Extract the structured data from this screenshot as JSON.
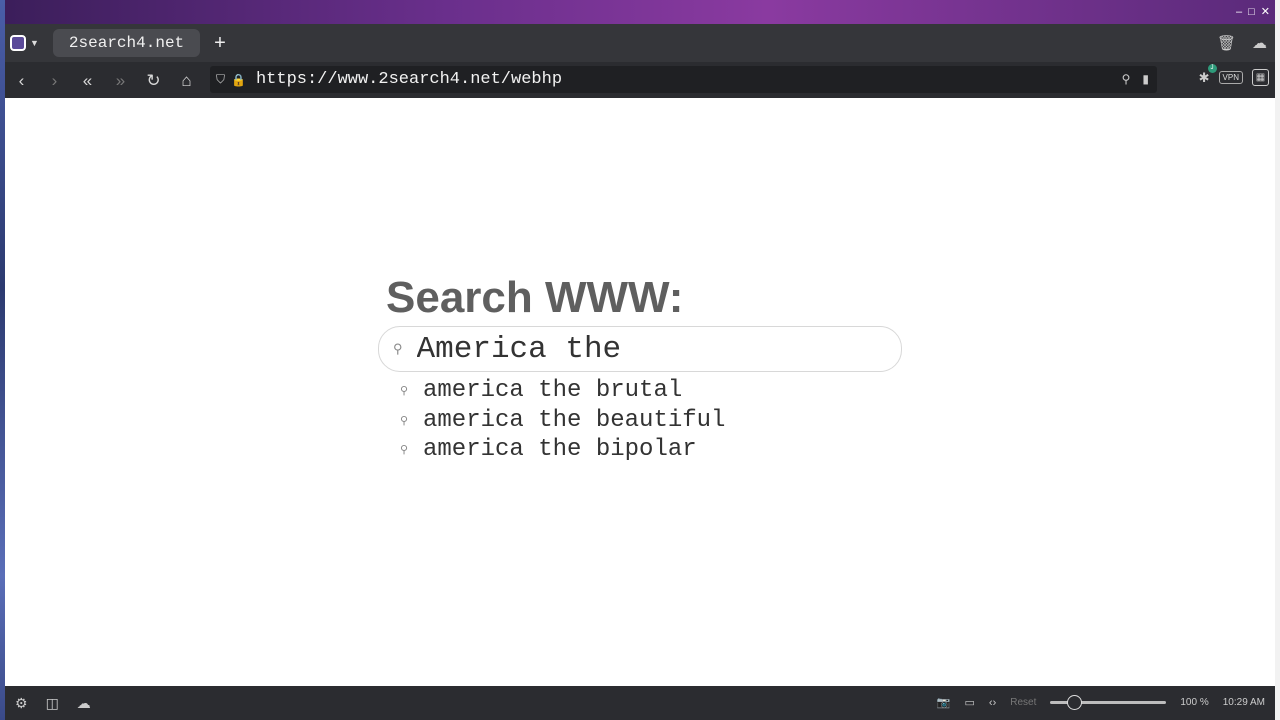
{
  "window": {
    "controls": [
      "–",
      "□",
      "✕"
    ]
  },
  "tabs": [
    {
      "label": "2search4.net"
    }
  ],
  "toolbar": {
    "url": "https://www.2search4.net/webhp",
    "vpn_label": "VPN",
    "ext_badge": "J"
  },
  "page": {
    "heading": "Search WWW:",
    "search": {
      "value": "America the"
    },
    "suggestions": [
      {
        "text": "america the brutal"
      },
      {
        "text": "america the beautiful"
      },
      {
        "text": "america the bipolar"
      }
    ]
  },
  "statusbar": {
    "reset_label": "Reset",
    "zoom": "100 %",
    "zoom_fraction": 0.2,
    "time": "10:29 AM"
  },
  "colors": {
    "accent": "#6a2f8c",
    "chrome": "#35363a",
    "heading": "#5f5f5f"
  }
}
